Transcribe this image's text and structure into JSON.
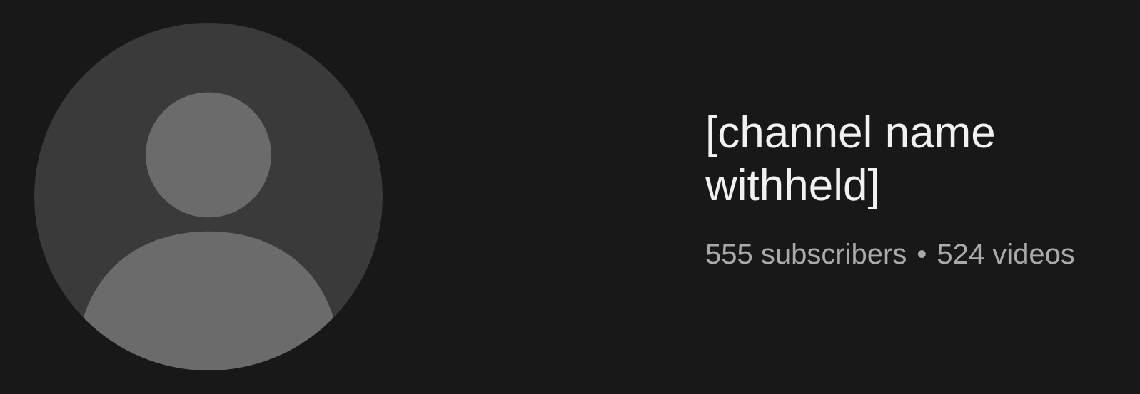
{
  "channel": {
    "name": "[channel name withheld]",
    "subscribers": "555 subscribers",
    "separator": "•",
    "videos": "524 videos"
  },
  "icons": {
    "avatar": "avatar-placeholder-icon"
  },
  "colors": {
    "background": "#181818",
    "title": "#f1f1f1",
    "meta": "#aaaaaa"
  }
}
